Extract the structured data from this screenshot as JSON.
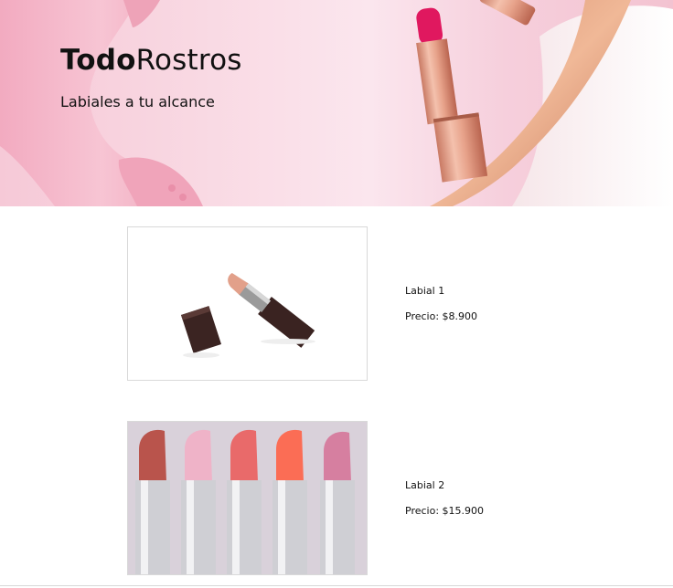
{
  "header": {
    "brand_bold": "Todo",
    "brand_regular": "Rostros",
    "tagline": "Labiales a tu alcance"
  },
  "products": [
    {
      "name": "Labial 1",
      "price_label": "Precio:",
      "price": "$8.900"
    },
    {
      "name": "Labial 2",
      "price_label": "Precio:",
      "price": "$15.900"
    }
  ],
  "colors": {
    "hero_pink": "#f9d9e3",
    "lipstick_magenta": "#e0185f",
    "rose_gold": "#e3a08a",
    "text": "#111111"
  }
}
